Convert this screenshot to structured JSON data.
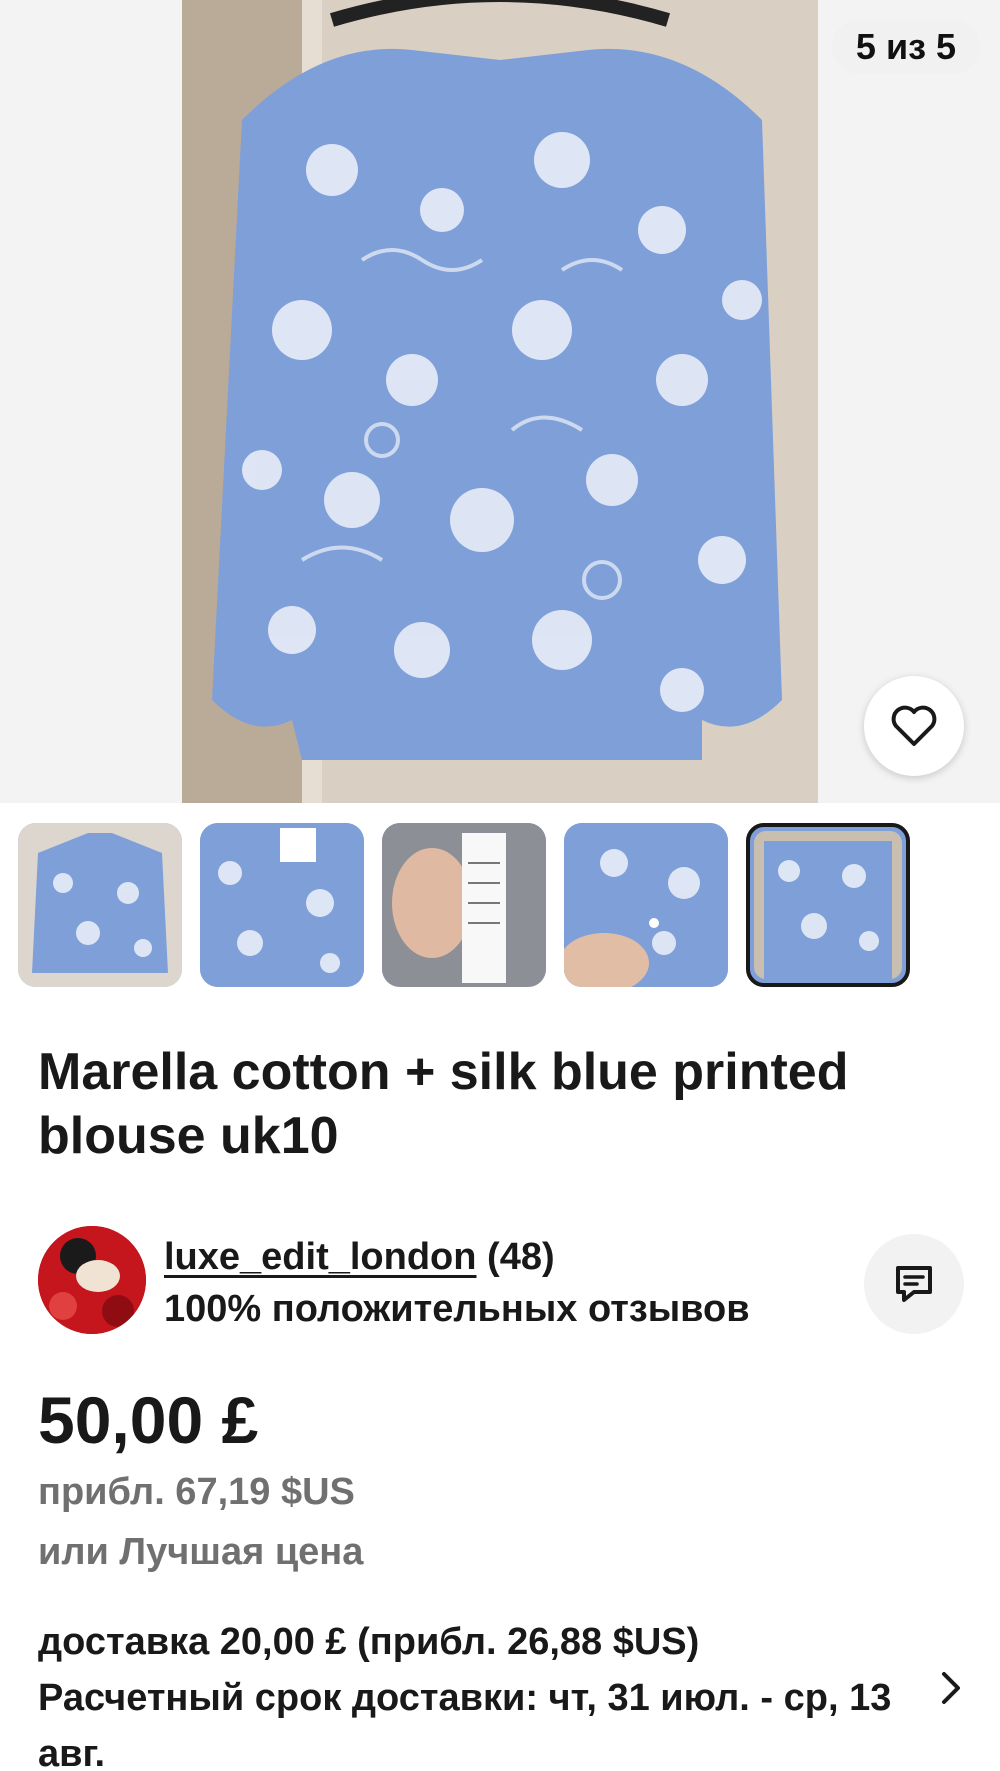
{
  "gallery": {
    "counter": "5 из 5",
    "favorite_icon": "heart-outline-icon",
    "thumbnails": [
      {
        "label": "blouse-front"
      },
      {
        "label": "blouse-tag"
      },
      {
        "label": "care-label"
      },
      {
        "label": "cuff-detail"
      },
      {
        "label": "blouse-back",
        "selected": true
      }
    ]
  },
  "listing": {
    "title": "Marella cotton + silk blue printed blouse uk10"
  },
  "seller": {
    "name": "luxe_edit_london",
    "rating_count": "(48)",
    "feedback": "100% положительных отзывов",
    "message_icon": "chat-bubble-icon"
  },
  "pricing": {
    "price": "50,00 £",
    "approx": "прибл. 67,19 $US",
    "best_offer": "или Лучшая цена"
  },
  "shipping": {
    "cost": "доставка 20,00 £ (прибл. 26,88 $US)",
    "estimate": "Расчетный срок доставки: чт, 31 июл. - ср, 13 авг."
  },
  "colors": {
    "text": "#191919",
    "muted": "#707070",
    "fabric_blue": "#7f9fd8"
  }
}
